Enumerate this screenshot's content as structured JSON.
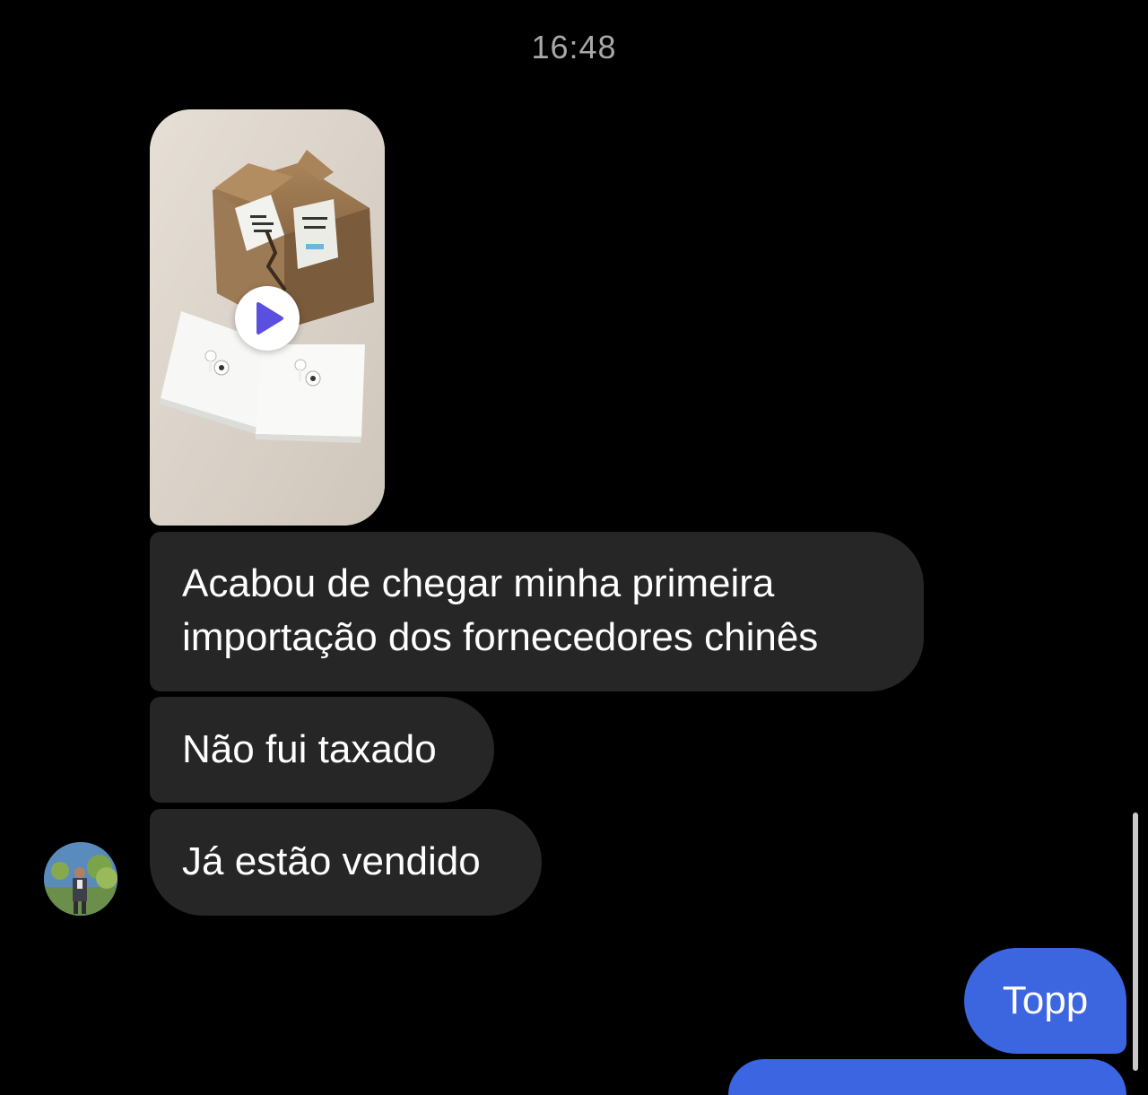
{
  "timestamp": "16:48",
  "messages": [
    {
      "type": "video",
      "from": "contact",
      "icon": "play-icon"
    },
    {
      "type": "text",
      "from": "contact",
      "lines": [
        "Acabou de chegar minha primeira",
        "importação dos fornecedores chinês"
      ]
    },
    {
      "type": "text",
      "from": "contact",
      "text": "Não fui taxado"
    },
    {
      "type": "text",
      "from": "contact",
      "text": "Já estão vendido"
    },
    {
      "type": "text",
      "from": "me",
      "text": "Topp"
    }
  ],
  "colors": {
    "background": "#000000",
    "received_bubble": "#262626",
    "sent_bubble": "#3c65e0",
    "play_icon": "#5b4fe0",
    "timestamp": "#a8a8a8"
  }
}
